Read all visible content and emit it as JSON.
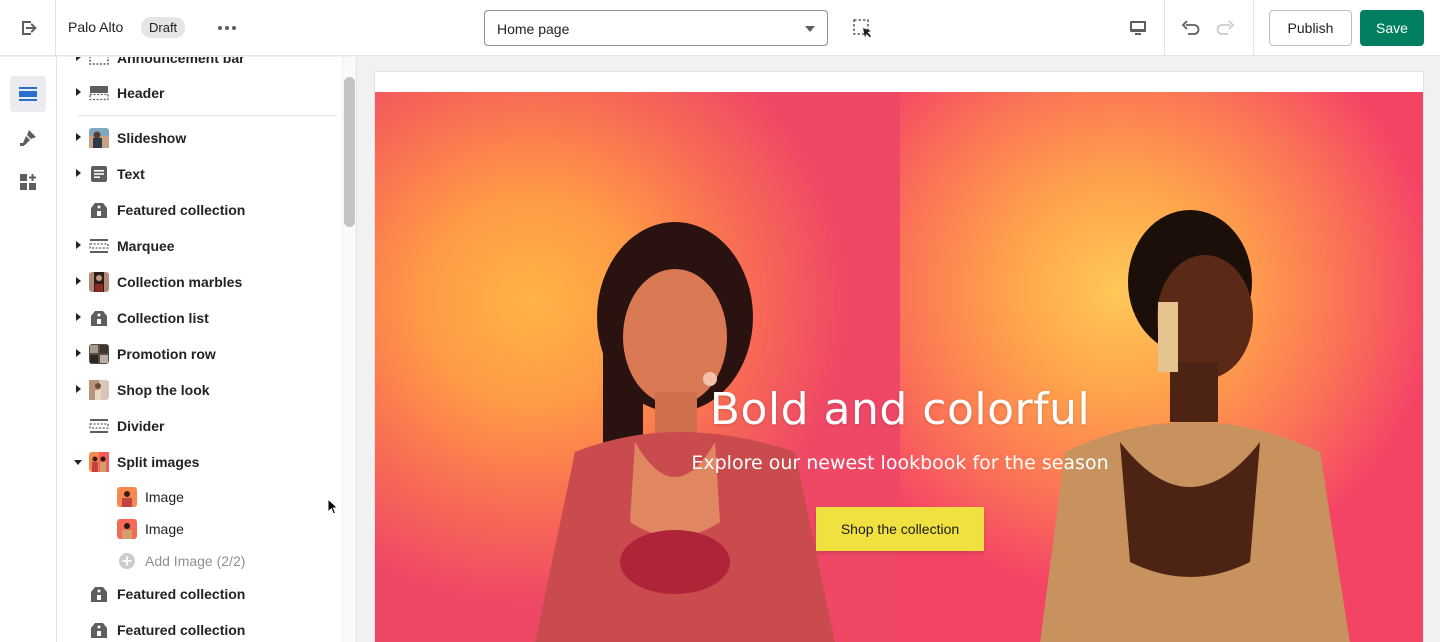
{
  "topbar": {
    "store_name": "Palo Alto",
    "status_badge": "Draft",
    "page_selector": "Home page",
    "publish_label": "Publish",
    "save_label": "Save",
    "accent_color": "#008060"
  },
  "rail": {
    "items": [
      {
        "icon": "sections-icon",
        "active": true
      },
      {
        "icon": "theme-settings-icon",
        "active": false
      },
      {
        "icon": "apps-icon",
        "active": false
      }
    ]
  },
  "sidebar": {
    "sections": [
      {
        "label": "Announcement bar",
        "icon": "announcement-icon",
        "expandable": true
      },
      {
        "label": "Header",
        "icon": "header-icon",
        "expandable": true
      },
      {
        "label": "Slideshow",
        "icon": "slideshow-thumb",
        "expandable": true
      },
      {
        "label": "Text",
        "icon": "text-icon",
        "expandable": true
      },
      {
        "label": "Featured collection",
        "icon": "collection-tag-icon",
        "expandable": false
      },
      {
        "label": "Marquee",
        "icon": "marquee-icon",
        "expandable": true
      },
      {
        "label": "Collection marbles",
        "icon": "marbles-thumb",
        "expandable": true
      },
      {
        "label": "Collection list",
        "icon": "collection-tag-icon",
        "expandable": true
      },
      {
        "label": "Promotion row",
        "icon": "promotion-thumb",
        "expandable": true
      },
      {
        "label": "Shop the look",
        "icon": "shop-look-thumb",
        "expandable": true
      },
      {
        "label": "Divider",
        "icon": "divider-icon",
        "expandable": false
      },
      {
        "label": "Split images",
        "icon": "split-images-thumb",
        "expandable": true,
        "expanded": true
      },
      {
        "label": "Featured collection",
        "icon": "collection-tag-icon",
        "expandable": false
      },
      {
        "label": "Featured collection",
        "icon": "collection-tag-icon",
        "expandable": false
      }
    ],
    "split_images_blocks": [
      {
        "label": "Image"
      },
      {
        "label": "Image"
      }
    ],
    "add_block_label": "Add Image (2/2)"
  },
  "hero": {
    "title": "Bold and colorful",
    "subtitle": "Explore our newest lookbook for the season",
    "cta_label": "Shop the collection",
    "cta_color": "#f0e040"
  }
}
